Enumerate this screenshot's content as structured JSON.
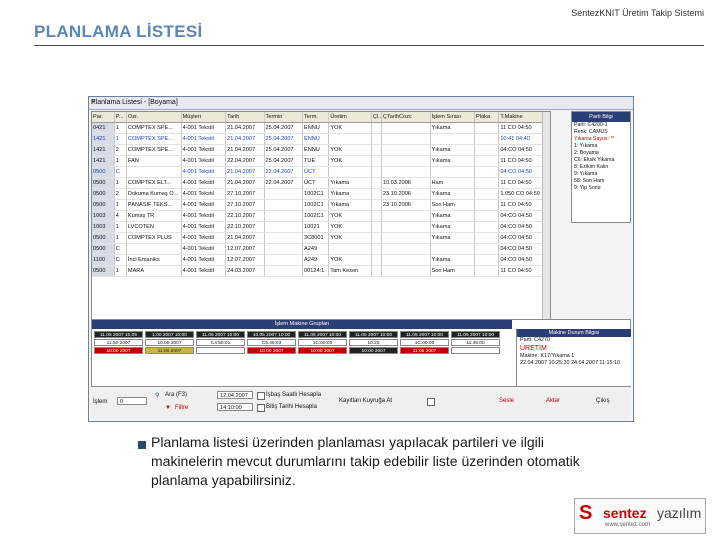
{
  "slide": {
    "title": "PLANLAMA LİSTESİ",
    "app_name": "SentezKNIT Üretim Takip Sistemi",
    "note": "Planlama listesi üzerinden planlaması yapılacak partileri ve ilgili makinelerin mevcut durumlarını takip edebilir liste üzerinden otomatik planlama yapabilirsiniz."
  },
  "window": {
    "title": "Planlama Listesi - [Boyama]",
    "close": "X"
  },
  "grid": {
    "columns": [
      "Par.",
      "P...",
      "Ozr.",
      "Müşteri",
      "Tarih",
      "Termin",
      "Term.",
      "Üretim",
      "Çl...",
      "ÇTarihCozc",
      "İşlem Sırası",
      "Plaka",
      "T.Makine"
    ],
    "rows": [
      {
        "style": "",
        "cells": [
          "0421",
          "1",
          "COMPTEX SPE...",
          "4-001 Tekstil",
          "21.04.2007",
          "25.04.2007",
          "ENNU",
          "YOK",
          "",
          "",
          "Yıkama",
          "",
          "11 CO 04:50"
        ]
      },
      {
        "style": "blue",
        "cells": [
          "1421",
          "1",
          "COMPTEX SPE...",
          "4-001 Tekstil",
          "21.04.2007",
          "25.04.2007",
          "ENNU",
          "",
          "",
          "",
          "",
          "",
          "10:41 04:40"
        ]
      },
      {
        "style": "",
        "cells": [
          "1421",
          "2",
          "COMPTEX SPE...",
          "4-001 Tekstil",
          "21.04.2007",
          "25.04.2007",
          "ENNU",
          "YOK",
          "",
          "",
          "Yıkama",
          "",
          "04:CO 04:50"
        ]
      },
      {
        "style": "",
        "cells": [
          "1421",
          "1",
          "FAN",
          "4-001 Tekstil",
          "22.04.2007",
          "25.04.2007",
          "TUE",
          "YOK",
          "",
          "",
          "Yıkama",
          "",
          "11 CO 04:50"
        ]
      },
      {
        "style": "blue",
        "cells": [
          "0500",
          "C",
          "",
          "4-001 Tekstil",
          "21.04.2007",
          "22.04.2007",
          "ÜCT",
          "",
          "",
          "",
          "",
          "",
          "04:CO 04:50"
        ]
      },
      {
        "style": "",
        "cells": [
          "0500",
          "1",
          "COMPTEX ELT...",
          "4-001 Tekstil",
          "21.04.2007",
          "22.04.2007",
          "ÜCT",
          "Yıkama",
          "",
          "10.03.2006",
          "Ham",
          "",
          "11 CO 04:50"
        ]
      },
      {
        "style": "",
        "cells": [
          "0500",
          "2",
          "Dokuma Kumaş O...",
          "4-001 Tekstil",
          "27.10.2007",
          "",
          "1002C1",
          "Yıkama",
          "",
          "23.10.2006",
          "Yıkama",
          "",
          "1.050 CO 04:50"
        ]
      },
      {
        "style": "",
        "cells": [
          "0500",
          "1",
          "PANASIF TEKS...",
          "4-001 Tekstil",
          "27.10.2007",
          "",
          "1002C1",
          "Yıkama",
          "",
          "23.10.2006",
          "Son Ham",
          "",
          "11 CO 04:50"
        ]
      },
      {
        "style": "",
        "cells": [
          "1003",
          "4",
          "Kumaş TR",
          "4-001 Tekstil",
          "22.10.2007",
          "",
          "1002C1",
          "YOK",
          "",
          "",
          "Yıkama",
          "",
          "04:CO 04:50"
        ]
      },
      {
        "style": "",
        "cells": [
          "1003",
          "1",
          "LVCOTEN",
          "4-001 Tekstil",
          "22.10.2007",
          "",
          "10021",
          "YOK",
          "",
          "",
          "Yıkama",
          "",
          "04:CO 04:50"
        ]
      },
      {
        "style": "",
        "cells": [
          "0500",
          "1",
          "COMPTEX PLUS",
          "4-001 Tekstil",
          "21.04.2007",
          "",
          "3C8001",
          "YOK",
          "",
          "",
          "Yıkama",
          "",
          "04:CO 04:50"
        ]
      },
      {
        "style": "",
        "cells": [
          "0500",
          "C",
          "",
          "4-001 Tekstil",
          "12.07.2007",
          "",
          "A249",
          "",
          "",
          "",
          "",
          "",
          "04:CO 04:50"
        ]
      },
      {
        "style": "",
        "cells": [
          "1100",
          "C",
          "İnci Emaniks",
          "4-001 Tekstil",
          "12.07.2007",
          "",
          "A249",
          "YOK",
          "",
          "",
          "Yıkama",
          "",
          "04:CO 04:50"
        ]
      },
      {
        "style": "",
        "cells": [
          "0500",
          "1",
          "MARA",
          "4-001 Tekstil",
          "24.03.2007",
          "",
          "00124:1",
          "Tam Kesen",
          "",
          "",
          "Son Ham",
          "",
          "11 CO 04:50"
        ]
      }
    ]
  },
  "side_panel": {
    "header": "Parti Bilgi",
    "lines": [
      {
        "text": "Parti: C4200-1",
        "style": ""
      },
      {
        "text": "Renk: CAMUS",
        "style": ""
      },
      {
        "text": "Yıkama Sayısı: **",
        "style": "red"
      },
      {
        "text": "1: Yıkama",
        "style": ""
      },
      {
        "text": "2: Boyama",
        "style": ""
      },
      {
        "text": "C6: Eksik Yikama",
        "style": ""
      },
      {
        "text": "8: Ezikim Kalın",
        "style": ""
      },
      {
        "text": "9: Yıkama",
        "style": ""
      },
      {
        "text": "58: Son Ham",
        "style": ""
      },
      {
        "text": "9: Yip Sonu",
        "style": ""
      }
    ]
  },
  "machines": {
    "title": "İşlem Makine Grupları",
    "row1": [
      {
        "text": "11.05 2007 10.05",
        "cls": "dark"
      },
      {
        "text": "1:00 2007 10:00",
        "cls": "dark"
      },
      {
        "text": "11.05 2007 10:00",
        "cls": "dark"
      },
      {
        "text": "10.05 2007 10:00",
        "cls": "dark"
      },
      {
        "text": "11.05 2007 10:00",
        "cls": "dark"
      },
      {
        "text": "11.05 2007 10:00",
        "cls": "dark"
      },
      {
        "text": "11.05 2007 10:00",
        "cls": "dark"
      },
      {
        "text": "11.05 2007 10:00",
        "cls": "dark"
      }
    ],
    "row2": [
      {
        "text": "11.50 2007",
        "cls": "white-bg"
      },
      {
        "text": "10.05 2007",
        "cls": "white-bg"
      },
      {
        "text": "C4:50:01",
        "cls": "white-bg"
      },
      {
        "text": "C5:45:03",
        "cls": "white-bg"
      },
      {
        "text": "1C:00:00",
        "cls": "white-bg"
      },
      {
        "text": "10:25",
        "cls": "white-bg"
      },
      {
        "text": "1C:00:00",
        "cls": "white-bg"
      },
      {
        "text": "11:45:00",
        "cls": "white-bg"
      }
    ],
    "row3": [
      {
        "text": "10:00 2007",
        "cls": "red-bg"
      },
      {
        "text": "11:00 2007",
        "cls": "yellow-bg"
      },
      {
        "text": "",
        "cls": "white-bg"
      },
      {
        "text": "10.00 2007",
        "cls": "red-bg"
      },
      {
        "text": "10:00 2007",
        "cls": "red-bg"
      },
      {
        "text": "10:00 2007",
        "cls": "dark"
      },
      {
        "text": "11:05 2007",
        "cls": "red-bg"
      },
      {
        "text": "",
        "cls": "white-bg"
      }
    ]
  },
  "durum": {
    "header": "Makine Durum Bilgisi",
    "machine": "Parti: C4270",
    "status": "ÜRETİM",
    "line1": "Makine: K17/Yıkama 1",
    "line2": "22.04.2007 10:25:20 24.04.2007 11:15:10"
  },
  "bottom": {
    "islem_label": "İşlem",
    "islem_value": "0",
    "ara_label": "Ara (F3)",
    "filtre_label": "Filtre",
    "date1": "12.04.2007",
    "date2": "14:10:00",
    "isbas_label": "İşbaş Saatlı Hesapla",
    "bitis_label": "Bitiş Tarihi Hesapla",
    "kayitlar_label": "Kayıtları Kuyruğa At",
    "sesle_label": "Sesle",
    "aktar_label": "Aktar",
    "cikis_label": "Çıkış"
  },
  "logo": {
    "mark": "S",
    "sentez": "sentez",
    "yazilim": "yazılım",
    "url": "www.sentez.com"
  }
}
